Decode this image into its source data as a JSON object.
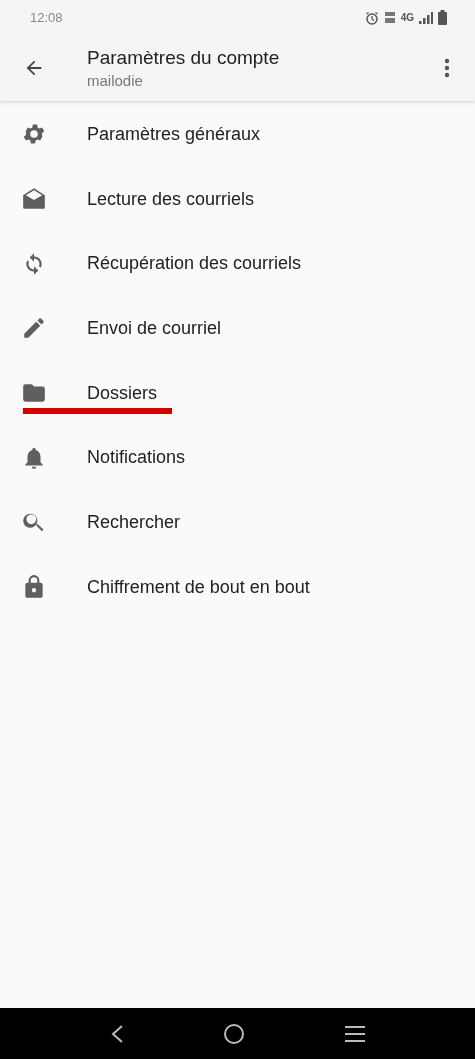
{
  "status_bar": {
    "time": "12:08",
    "network": "4G"
  },
  "app_bar": {
    "title": "Paramètres du compte",
    "subtitle": "mailodie"
  },
  "items": [
    {
      "label": "Paramètres généraux",
      "kind": "gear",
      "highlighted": false
    },
    {
      "label": "Lecture des courriels",
      "kind": "mail",
      "highlighted": false
    },
    {
      "label": "Récupération des courriels",
      "kind": "sync",
      "highlighted": false
    },
    {
      "label": "Envoi de courriel",
      "kind": "pencil",
      "highlighted": false
    },
    {
      "label": "Dossiers",
      "kind": "folder",
      "highlighted": true
    },
    {
      "label": "Notifications",
      "kind": "bell",
      "highlighted": false
    },
    {
      "label": "Rechercher",
      "kind": "search",
      "highlighted": false
    },
    {
      "label": "Chiffrement de bout en bout",
      "kind": "lock",
      "highlighted": false
    }
  ]
}
